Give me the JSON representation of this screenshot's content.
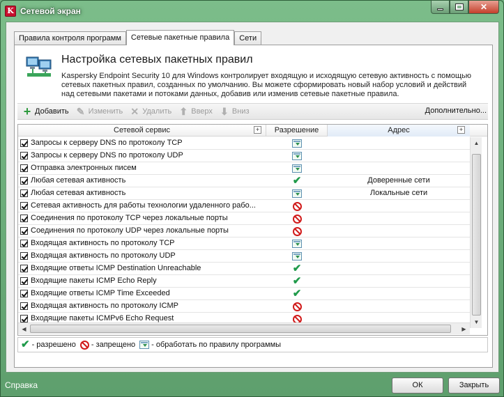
{
  "window": {
    "title": "Сетевой экран",
    "app_icon_letter": "K",
    "close_glyph": "✕"
  },
  "tabs": [
    {
      "label": "Правила контроля программ",
      "active": false
    },
    {
      "label": "Сетевые пакетные правила",
      "active": true
    },
    {
      "label": "Сети",
      "active": false
    }
  ],
  "header": {
    "title": "Настройка сетевых пакетных правил",
    "description": "Kaspersky Endpoint Security 10 для Windows контролирует входящую и исходящую сетевую активность с помощью сетевых пакетных правил, созданных по умолчанию. Вы можете сформировать новый набор условий и действий над сетевыми пакетами и потоками данных, добавив или изменив сетевые пакетные правила."
  },
  "toolbar": {
    "add": "Добавить",
    "edit": "Изменить",
    "delete": "Удалить",
    "up": "Вверх",
    "down": "Вниз",
    "more": "Дополнительно..."
  },
  "table": {
    "columns": {
      "service": "Сетевой сервис",
      "permission": "Разрешение",
      "address": "Адрес"
    },
    "rows": [
      {
        "service": "Запросы к серверу DNS по протоколу TCP",
        "permission": "rule",
        "address": "",
        "checked": true
      },
      {
        "service": "Запросы к серверу DNS по протоколу UDP",
        "permission": "rule",
        "address": "",
        "checked": true
      },
      {
        "service": "Отправка электронных писем",
        "permission": "rule",
        "address": "",
        "checked": true
      },
      {
        "service": "Любая сетевая активность",
        "permission": "allow",
        "address": "Доверенные сети",
        "checked": true
      },
      {
        "service": "Любая сетевая активность",
        "permission": "rule",
        "address": "Локальные сети",
        "checked": true
      },
      {
        "service": "Сетевая активность для работы технологии удаленного рабо...",
        "permission": "deny",
        "address": "",
        "checked": true
      },
      {
        "service": "Соединения по протоколу TCP через локальные порты",
        "permission": "deny",
        "address": "",
        "checked": true
      },
      {
        "service": "Соединения по протоколу UDP через локальные порты",
        "permission": "deny",
        "address": "",
        "checked": true
      },
      {
        "service": "Входящая активность по протоколу TCP",
        "permission": "rule",
        "address": "",
        "checked": true
      },
      {
        "service": "Входящая активность по протоколу UDP",
        "permission": "rule",
        "address": "",
        "checked": true
      },
      {
        "service": "Входящие ответы ICMP Destination Unreachable",
        "permission": "allow",
        "address": "",
        "checked": true
      },
      {
        "service": "Входящие пакеты ICMP Echo Reply",
        "permission": "allow",
        "address": "",
        "checked": true
      },
      {
        "service": "Входящие ответы ICMP Time Exceeded",
        "permission": "allow",
        "address": "",
        "checked": true
      },
      {
        "service": "Входящая активность по протоколу ICMP",
        "permission": "deny",
        "address": "",
        "checked": true
      },
      {
        "service": "Входящие пакеты ICMPv6 Echo Request",
        "permission": "deny",
        "address": "",
        "checked": true
      }
    ]
  },
  "legend": {
    "allowed": "- разрешено",
    "denied": "- запрещено",
    "by_rule": "- обработать по правилу программы"
  },
  "footer": {
    "help": "Справка",
    "ok": "ОК",
    "close": "Закрыть"
  },
  "colors": {
    "frame": "#6fae7e",
    "allow": "#1f9a4a",
    "deny": "#d11a1a"
  }
}
